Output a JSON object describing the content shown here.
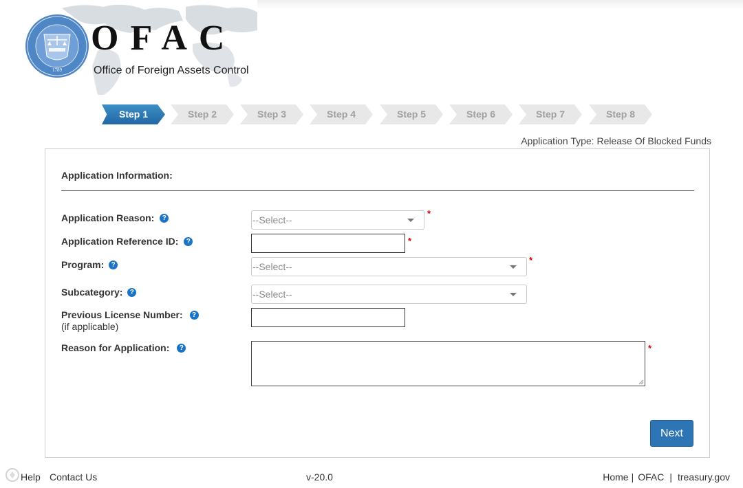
{
  "header": {
    "brand_name": "OFAC",
    "brand_subtitle": "Office of Foreign Assets Control",
    "seal_icon": "treasury-seal-icon"
  },
  "steps": [
    {
      "label": "Step 1",
      "active": true
    },
    {
      "label": "Step 2",
      "active": false
    },
    {
      "label": "Step 3",
      "active": false
    },
    {
      "label": "Step 4",
      "active": false
    },
    {
      "label": "Step 5",
      "active": false
    },
    {
      "label": "Step 6",
      "active": false
    },
    {
      "label": "Step 7",
      "active": false
    },
    {
      "label": "Step 8",
      "active": false
    }
  ],
  "application_type": "Application Type: Release Of Blocked Funds",
  "form": {
    "section_title": "Application Information:",
    "fields": {
      "application_reason": {
        "label": "Application Reason:",
        "value": "--Select--",
        "required": true
      },
      "reference_id": {
        "label": "Application Reference ID:",
        "value": "",
        "required": true
      },
      "program": {
        "label": "Program:",
        "value": "--Select--",
        "required": true
      },
      "subcategory": {
        "label": "Subcategory:",
        "value": "--Select--",
        "required": false
      },
      "previous_license": {
        "label": "Previous License Number:",
        "note": "(if applicable)",
        "value": "",
        "required": false
      },
      "reason_for_application": {
        "label": "Reason for Application:",
        "value": "",
        "required": true
      }
    },
    "required_marker": "*",
    "help_glyph": "?",
    "next_label": "Next"
  },
  "footer": {
    "help": "Help",
    "contact": "Contact Us",
    "version": "v-20.0",
    "links": [
      "Home",
      "OFAC",
      "treasury.gov"
    ],
    "separator": "|"
  },
  "colors": {
    "accent": "#2e75b6",
    "active_step": "#2a77b6",
    "inactive_step": "#e8e8e8",
    "required": "#d60000",
    "help_icon": "#1a73c6"
  }
}
